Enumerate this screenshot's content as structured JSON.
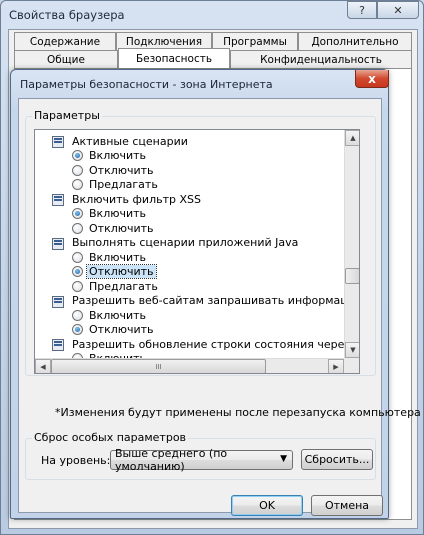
{
  "background_window": {
    "title": "Свойства браузера",
    "help_label": "?",
    "close_label": "✕",
    "tabs_row1": [
      "Содержание",
      "Подключения",
      "Программы",
      "Дополнительно"
    ],
    "tabs_row2": [
      "Общие",
      "Безопасность",
      "Конфиденциальность"
    ],
    "selected_tab": "Безопасность"
  },
  "dialog": {
    "title": "Параметры безопасности - зона Интернета",
    "close_label": "x",
    "settings_group_label": "Параметры",
    "settings": [
      {
        "type": "header",
        "label": "Активные сценарии",
        "icon": "settings-script-icon"
      },
      {
        "type": "option",
        "label": "Включить",
        "checked": true
      },
      {
        "type": "option",
        "label": "Отключить",
        "checked": false
      },
      {
        "type": "option",
        "label": "Предлагать",
        "checked": false
      },
      {
        "type": "header",
        "label": "Включить фильтр XSS",
        "icon": "settings-script-icon"
      },
      {
        "type": "option",
        "label": "Включить",
        "checked": true
      },
      {
        "type": "option",
        "label": "Отключить",
        "checked": false
      },
      {
        "type": "header",
        "label": "Выполнять сценарии приложений Java",
        "icon": "settings-script-icon"
      },
      {
        "type": "option",
        "label": "Включить",
        "checked": false
      },
      {
        "type": "option",
        "label": "Отключить",
        "checked": true,
        "selected": true
      },
      {
        "type": "option",
        "label": "Предлагать",
        "checked": false
      },
      {
        "type": "header",
        "label": "Разрешить веб-сайтам запрашивать информацию с помо",
        "icon": "settings-script-icon"
      },
      {
        "type": "option",
        "label": "Включить",
        "checked": false
      },
      {
        "type": "option",
        "label": "Отключить",
        "checked": true
      },
      {
        "type": "header",
        "label": "Разрешить обновление строки состояния через сценари",
        "icon": "settings-script-icon"
      },
      {
        "type": "option",
        "label": "Включить",
        "checked": false
      }
    ],
    "note": "*Изменения будут применены после перезапуска компьютера",
    "reset_group_label": "Сброс особых параметров",
    "level_label": "На уровень:",
    "level_value": "Выше среднего (по умолчанию)",
    "reset_button": "Сбросить...",
    "ok_button": "OK",
    "cancel_button": "Отмена",
    "scroll_grip": "III"
  }
}
